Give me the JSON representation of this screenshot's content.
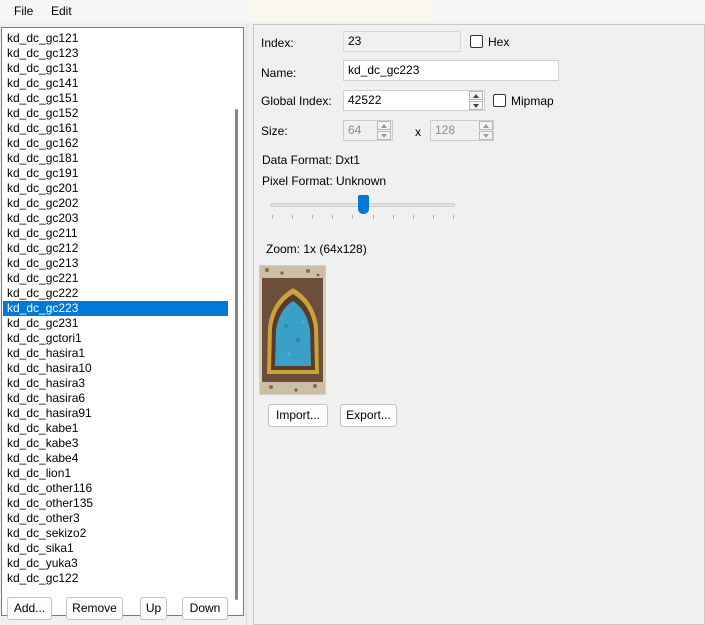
{
  "menu": {
    "items": [
      "File",
      "Edit"
    ]
  },
  "texture_list": {
    "items": [
      "kd_dc_gc121",
      "kd_dc_gc123",
      "kd_dc_gc131",
      "kd_dc_gc141",
      "kd_dc_gc151",
      "kd_dc_gc152",
      "kd_dc_gc161",
      "kd_dc_gc162",
      "kd_dc_gc181",
      "kd_dc_gc191",
      "kd_dc_gc201",
      "kd_dc_gc202",
      "kd_dc_gc203",
      "kd_dc_gc211",
      "kd_dc_gc212",
      "kd_dc_gc213",
      "kd_dc_gc221",
      "kd_dc_gc222",
      "kd_dc_gc223",
      "kd_dc_gc231",
      "kd_dc_gctori1",
      "kd_dc_hasira1",
      "kd_dc_hasira10",
      "kd_dc_hasira3",
      "kd_dc_hasira6",
      "kd_dc_hasira91",
      "kd_dc_kabe1",
      "kd_dc_kabe3",
      "kd_dc_kabe4",
      "kd_dc_lion1",
      "kd_dc_other116",
      "kd_dc_other135",
      "kd_dc_other3",
      "kd_dc_sekizo2",
      "kd_dc_sika1",
      "kd_dc_yuka3",
      "kd_dc_gc122"
    ],
    "selected": "kd_dc_gc223"
  },
  "list_buttons": {
    "add": "Add...",
    "remove": "Remove",
    "up": "Up",
    "down": "Down"
  },
  "properties": {
    "index_label": "Index:",
    "index_value": "23",
    "hex_label": "Hex",
    "hex_checked": false,
    "name_label": "Name:",
    "name_value": "kd_dc_gc223",
    "global_index_label": "Global Index:",
    "global_index_value": "42522",
    "mipmap_label": "Mipmap",
    "mipmap_checked": false,
    "size_label": "Size:",
    "size_width": "64",
    "size_x": "x",
    "size_height": "128",
    "data_format": "Data Format: Dxt1",
    "pixel_format": "Pixel Format: Unknown",
    "zoom_label": "Zoom: 1x (64x128)",
    "zoom_level_fraction": 0.5,
    "import_label": "Import...",
    "export_label": "Export..."
  },
  "colors": {
    "selection": "#0078d7",
    "slider": "#0078d7",
    "texture_blue": "#3aa0c8",
    "texture_gold": "#d8b030"
  }
}
